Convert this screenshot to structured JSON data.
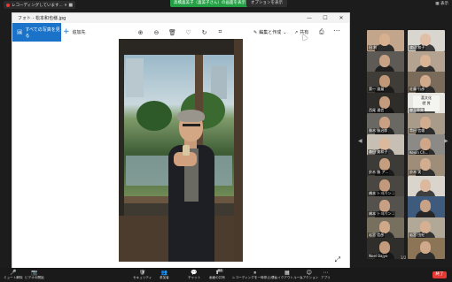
{
  "zoom_top": {
    "recording_label": "レコーディングしています...",
    "share_banner": "高橋喜美子（喜美子さん）の画面を表示しています",
    "view_option": "オプションを表示",
    "layout": "表示"
  },
  "photos_window": {
    "title": "フォト - 松本和也様.jpg",
    "controls": [
      "—",
      "☐",
      "✕"
    ],
    "all_photos": "すべての写真を見る",
    "add_to": "追加先",
    "edit_create": "編集と作成",
    "share": "共有"
  },
  "gallery": {
    "page_indicator": "1/2",
    "tiles": [
      {
        "name": "田 利",
        "bg": "#c2a58a",
        "face": "#d7b08f",
        "torso": "#2b2b2b"
      },
      {
        "name": "渡辺 和子",
        "bg": "#d8d6cf",
        "face": "#e0bfa6",
        "torso": "#3a3a3a"
      },
      {
        "name": "",
        "bg": "#5e5b56",
        "face": "#c9a184",
        "torso": "#202020"
      },
      {
        "name": "",
        "bg": "#b3a390",
        "face": "#d8b394",
        "torso": "#303030"
      },
      {
        "name": "第一 渡邉",
        "bg": "#403d38",
        "face": "#c09878",
        "torso": "#1c1c1c"
      },
      {
        "name": "佐藤 行彦",
        "bg": "#7a6b5b",
        "face": "#d1aa8c",
        "torso": "#2a2a2a"
      },
      {
        "name": "西尾 通信",
        "bg": "#2e2d2a",
        "face": "#c49b7c",
        "torso": "#151515"
      },
      {
        "name": "森玉恵美",
        "bg": "#e8e6e1",
        "face": "#e0c2aa",
        "torso": "#444",
        "text": "喜文化\n就 賞"
      },
      {
        "name": "勝木 勝治郎",
        "bg": "#6a6863",
        "face": "#c9a083",
        "torso": "#242424"
      },
      {
        "name": "貴田 信雄",
        "bg": "#a99b8a",
        "face": "#d2ac8f",
        "torso": "#2c2c2c"
      },
      {
        "name": "森田 美和子",
        "bg": "#c7bfb3",
        "face": "#dcb89c",
        "torso": "#383838"
      },
      {
        "name": "Kevin Ch...",
        "bg": "#8b8a86",
        "face": "#cfa688",
        "torso": "#2d2d2d"
      },
      {
        "name": "鈴木 勝 ア...",
        "bg": "#3c3b38",
        "face": "#c59d7f",
        "torso": "#1a1a1a"
      },
      {
        "name": "鈴木 実",
        "bg": "#9d8d79",
        "face": "#d3ad8f",
        "torso": "#2f2f2f"
      },
      {
        "name": "橋本 トヨパン...",
        "bg": "#4a4743",
        "face": "#c29a7b",
        "torso": "#1d1d1d"
      },
      {
        "name": "",
        "bg": "#d9d4cc",
        "face": "#dcb99e",
        "torso": "#3e3e3e"
      },
      {
        "name": "橋本 トヨパン...",
        "bg": "#55524d",
        "face": "#c7a083",
        "torso": "#222"
      },
      {
        "name": "",
        "bg": "#3e5b7e",
        "face": "#c8a285",
        "torso": "#262626"
      },
      {
        "name": "岩宮 信彦",
        "bg": "#77705f",
        "face": "#cfa789",
        "torso": "#2a2a2a"
      },
      {
        "name": "岩宮 由紀",
        "bg": "#b1a897",
        "face": "#d6b092",
        "torso": "#333"
      },
      {
        "name": "Noel Bajyo",
        "bg": "#2f2e2b",
        "face": "#c39c7e",
        "torso": "#181818"
      },
      {
        "name": "",
        "bg": "#8c7457",
        "face": "#d0a98b",
        "torso": "#2b2b2b"
      }
    ]
  },
  "zoom_bottom": {
    "items": [
      {
        "icon": "🎤",
        "label": "ミュート解除",
        "icon_name": "microphone-icon",
        "red": false
      },
      {
        "icon": "📷",
        "label": "ビデオの開始",
        "icon_name": "video-icon",
        "red": false
      },
      {
        "icon": "🛡",
        "label": "セキュリティ",
        "icon_name": "shield-icon",
        "red": false
      },
      {
        "icon": "👥",
        "label": "参加者",
        "icon_name": "participants-icon",
        "red": false
      },
      {
        "icon": "💬",
        "label": "チャット",
        "icon_name": "chat-icon",
        "red": false
      },
      {
        "icon": "⬆",
        "label": "画面の共有",
        "icon_name": "share-screen-icon",
        "red": false
      },
      {
        "icon": "⏸",
        "label": "レコーディングを一時停止/停止",
        "icon_name": "pause-record-icon",
        "red": false
      },
      {
        "icon": "▦",
        "label": "ブレイクアウトルーム",
        "icon_name": "breakout-icon",
        "red": false
      },
      {
        "icon": "😊",
        "label": "リアクション",
        "icon_name": "reaction-icon",
        "red": false
      },
      {
        "icon": "⋯",
        "label": "アプリ",
        "icon_name": "apps-icon",
        "red": false
      }
    ],
    "participant_count": "84",
    "end_label": "終了"
  }
}
